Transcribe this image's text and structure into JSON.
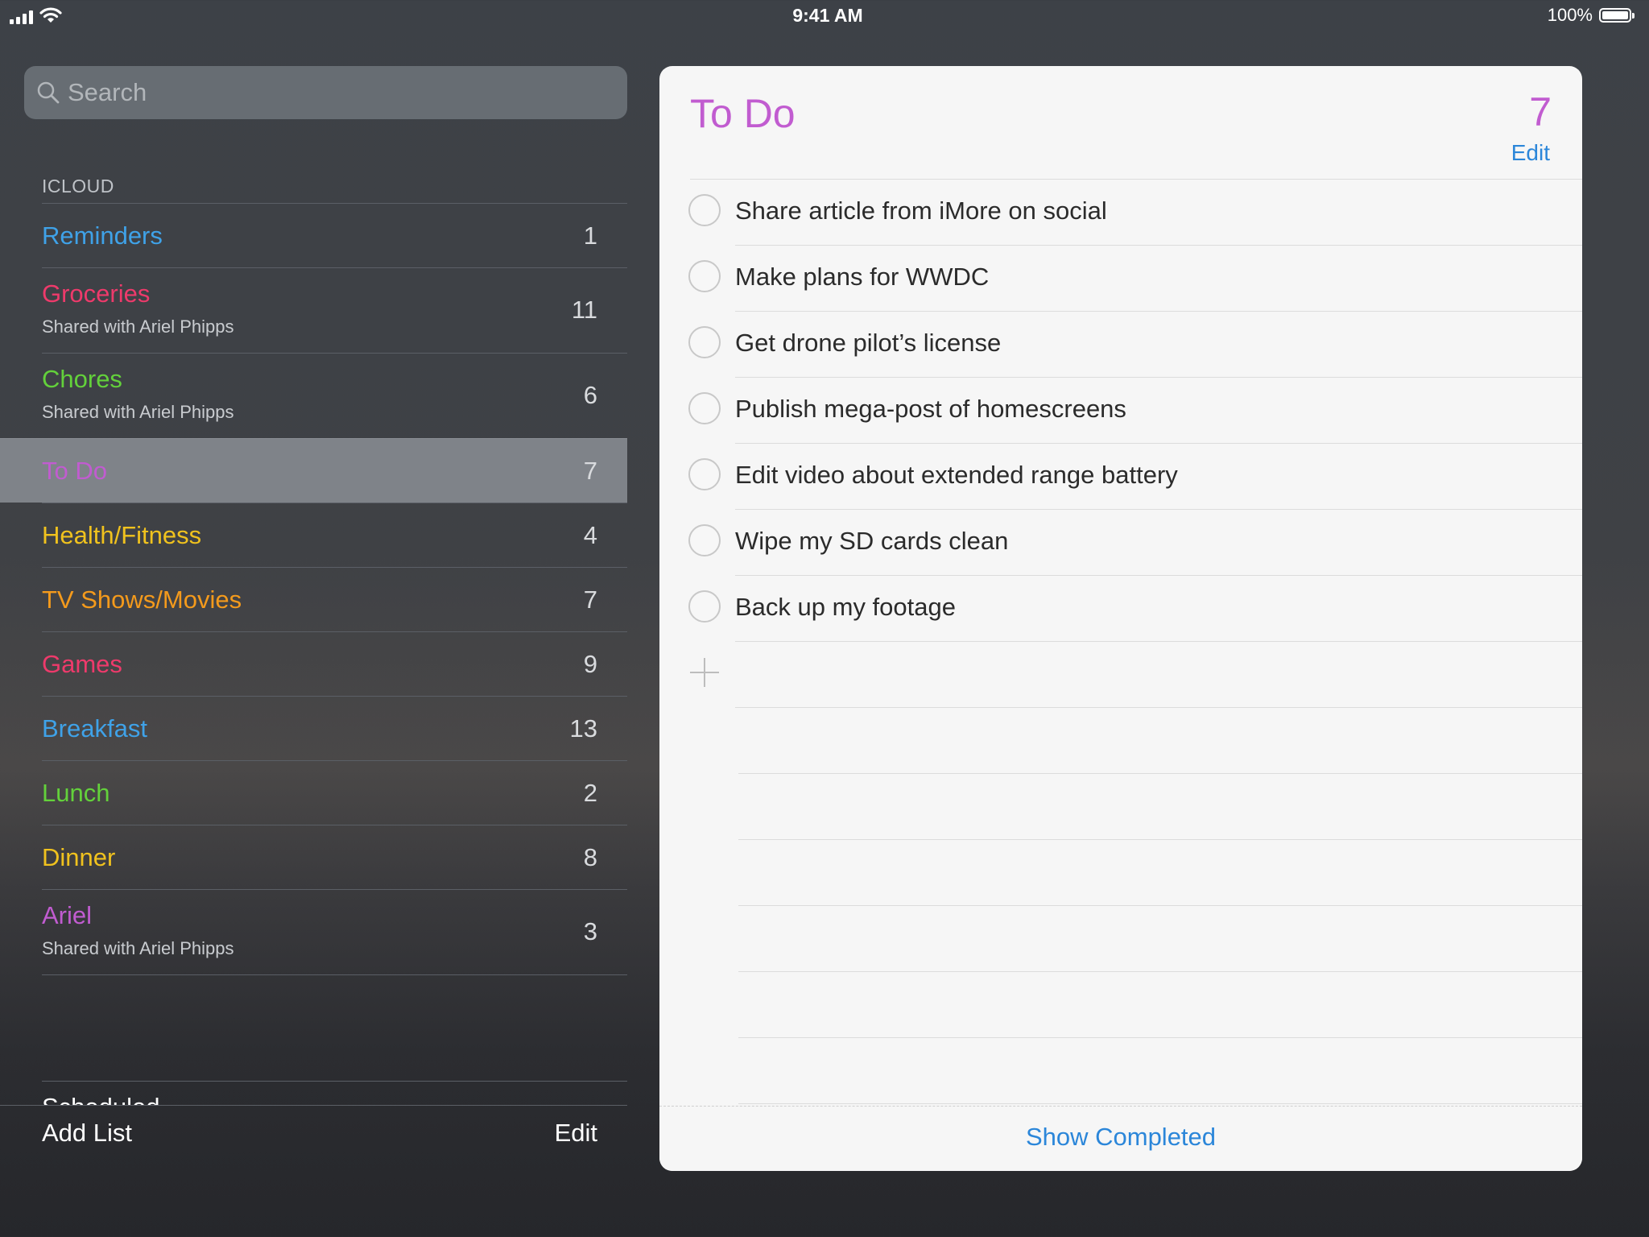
{
  "status_bar": {
    "time": "9:41 AM",
    "battery_text": "100%",
    "battery_level": 1.0
  },
  "sidebar": {
    "search_placeholder": "Search",
    "section_header": "ICLOUD",
    "lists": [
      {
        "name": "Reminders",
        "count": "1",
        "subtitle": "",
        "color": "#3fa2e8"
      },
      {
        "name": "Groceries",
        "count": "11",
        "subtitle": "Shared with Ariel Phipps",
        "color": "#ee3a6b"
      },
      {
        "name": "Chores",
        "count": "6",
        "subtitle": "Shared with Ariel Phipps",
        "color": "#63d13b"
      },
      {
        "name": "To Do",
        "count": "7",
        "subtitle": "",
        "color": "#c15cd0",
        "selected": true
      },
      {
        "name": "Health/Fitness",
        "count": "4",
        "subtitle": "",
        "color": "#f0c21e"
      },
      {
        "name": "TV Shows/Movies",
        "count": "7",
        "subtitle": "",
        "color": "#f49a1c"
      },
      {
        "name": "Games",
        "count": "9",
        "subtitle": "",
        "color": "#ee3a6b"
      },
      {
        "name": "Breakfast",
        "count": "13",
        "subtitle": "",
        "color": "#3fa2e8"
      },
      {
        "name": "Lunch",
        "count": "2",
        "subtitle": "",
        "color": "#63d13b"
      },
      {
        "name": "Dinner",
        "count": "8",
        "subtitle": "",
        "color": "#f0c21e"
      },
      {
        "name": "Ariel",
        "count": "3",
        "subtitle": "Shared with Ariel Phipps",
        "color": "#c15cd0"
      }
    ],
    "scheduled_label": "Scheduled",
    "add_list_label": "Add List",
    "edit_label": "Edit"
  },
  "detail": {
    "title": "To Do",
    "count": "7",
    "edit_label": "Edit",
    "accent_color": "#c15cd0",
    "items": [
      "Share article from iMore on social",
      "Make plans for WWDC",
      "Get drone pilot’s license",
      "Publish mega-post of homescreens",
      "Edit video about extended range battery",
      "Wipe my SD cards clean",
      "Back up my footage"
    ],
    "show_completed_label": "Show Completed"
  }
}
